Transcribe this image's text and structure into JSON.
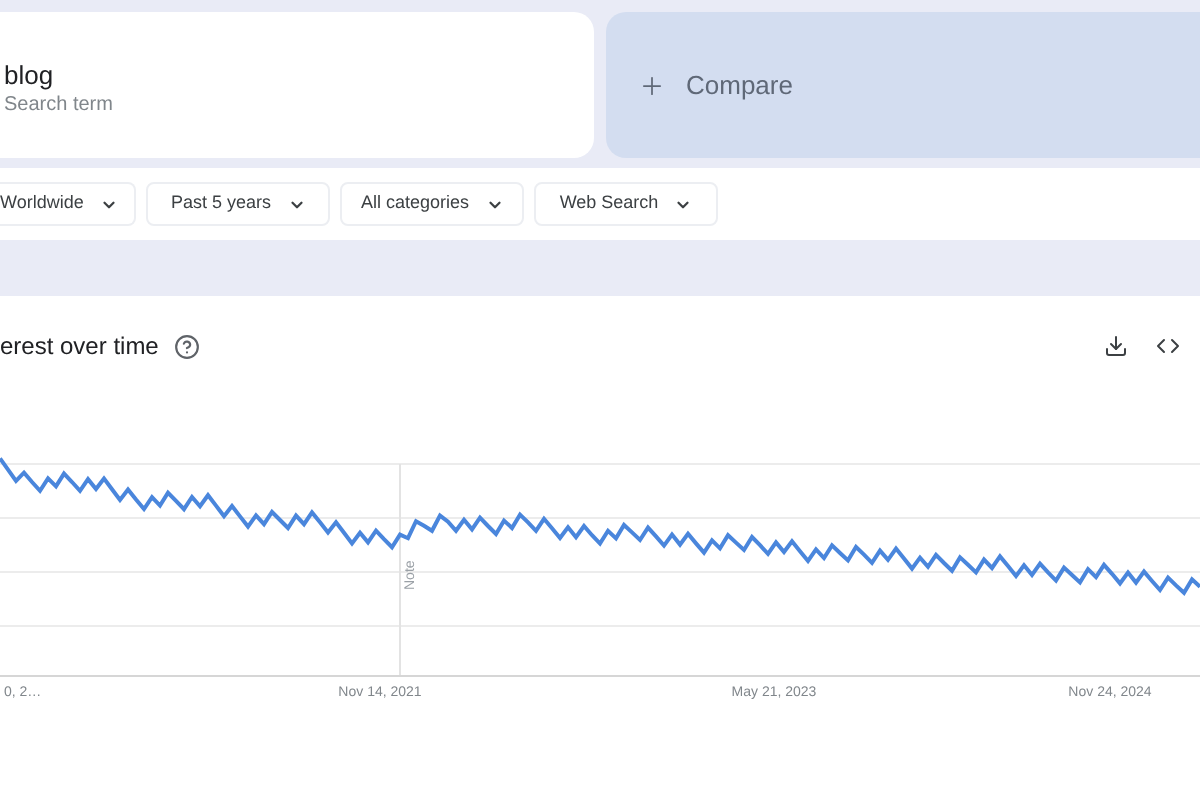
{
  "search_term": {
    "value": "blog",
    "placeholder": "Search term"
  },
  "compare": {
    "label": "Compare"
  },
  "filters": [
    {
      "label": "Worldwide"
    },
    {
      "label": "Past 5 years"
    },
    {
      "label": "All categories"
    },
    {
      "label": "Web Search"
    }
  ],
  "interest_panel": {
    "title": "erest over time",
    "note": "Note",
    "x_labels": [
      "0, 2…",
      "Nov 14, 2021",
      "May 21, 2023",
      "Nov 24, 2024"
    ]
  }
}
